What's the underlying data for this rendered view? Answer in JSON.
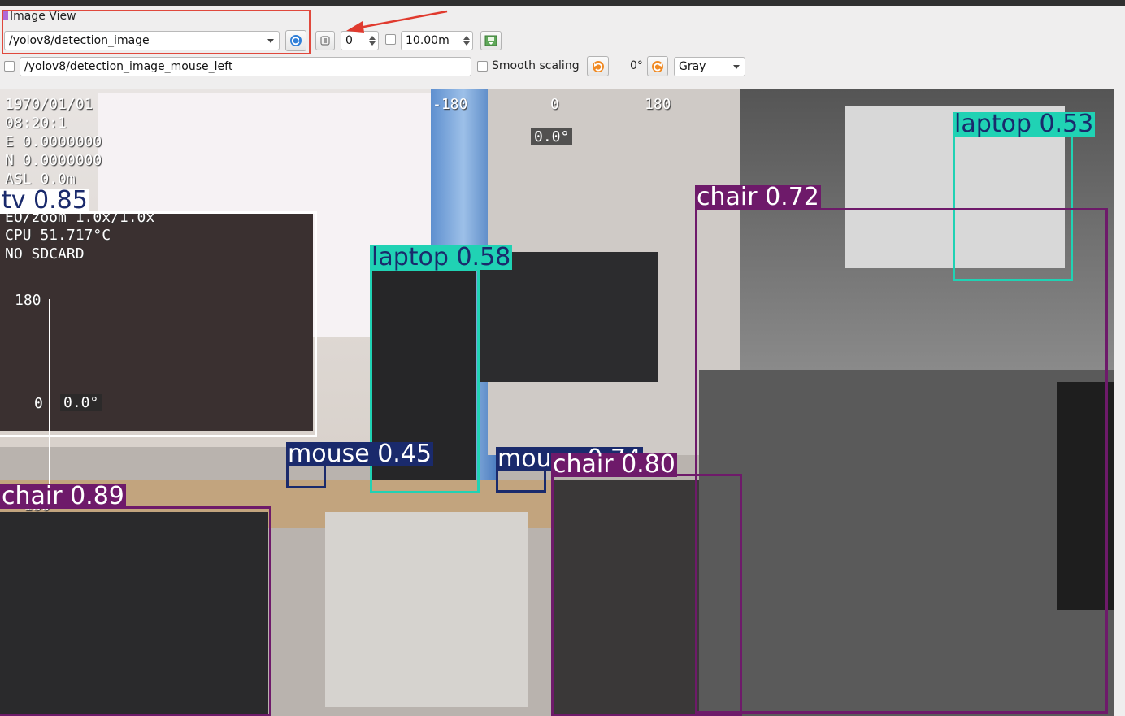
{
  "window": {
    "title": "Image View"
  },
  "toolbar": {
    "topic_value": "/yolov8/detection_image",
    "spin_value": "0",
    "distance_value": "10.00m",
    "mouse_topic_value": "/yolov8/detection_image_mouse_left",
    "smooth_label": "Smooth scaling",
    "rotation_label": "0°",
    "color_value": "Gray"
  },
  "osd": {
    "date": "1970/01/01",
    "time": "08:20:1",
    "east": "E 0.0000000",
    "north": "N 0.0000000",
    "asl": "ASL 0.0m",
    "zoom": "EO/zoom 1.0x/1.0x",
    "cpu": "CPU 51.717°C",
    "sdcard": "NO SDCARD",
    "yaw_ticks": [
      "-180",
      "0",
      "180"
    ],
    "yaw_value": "0.0°",
    "pitch_top": "180",
    "pitch_zero": "0",
    "pitch_value": "0.0°",
    "pitch_bottom": "-180"
  },
  "detections": [
    {
      "label": "tv 0.85",
      "color": "#1a2a6c"
    },
    {
      "label": "laptop 0.58",
      "color": "#20d2b4"
    },
    {
      "label": "laptop 0.53",
      "color": "#20d2b4"
    },
    {
      "label": "chair 0.72",
      "color": "#6e1a6a"
    },
    {
      "label": "mouse 0.45",
      "color": "#1a2a6c"
    },
    {
      "label": "mouse 0.74",
      "color": "#1a2a6c"
    },
    {
      "label": "chair 0.80",
      "color": "#6e1a6a"
    },
    {
      "label": "chair 0.89",
      "color": "#6e1a6a"
    }
  ]
}
